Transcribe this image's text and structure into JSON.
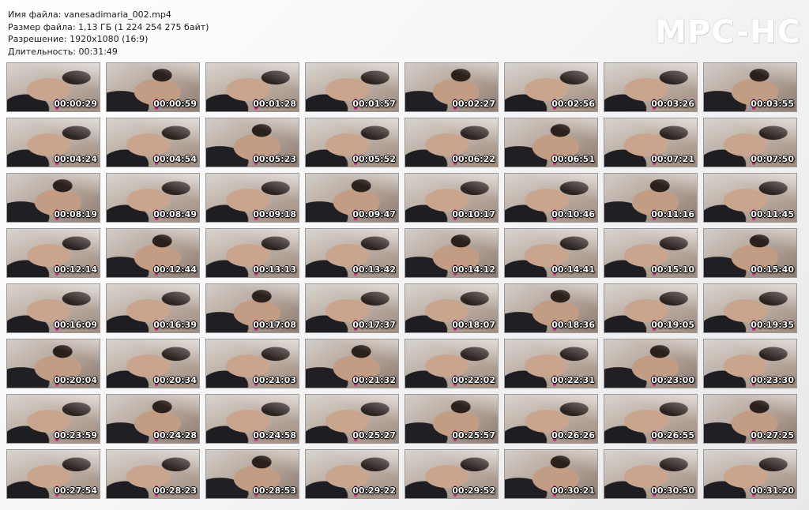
{
  "file_info": {
    "name_line": "Имя файла: vanesadimaria_002.mp4",
    "size_line": "Размер файла: 1,13 ГБ (1 224 254 275 байт)",
    "resolution_line": "Разрешение: 1920x1080 (16:9)",
    "duration_line": "Длительность: 00:31:49"
  },
  "logo": "MPC-HC",
  "thumbnails": [
    "00:00:29",
    "00:00:59",
    "00:01:28",
    "00:01:57",
    "00:02:27",
    "00:02:56",
    "00:03:26",
    "00:03:55",
    "00:04:24",
    "00:04:54",
    "00:05:23",
    "00:05:52",
    "00:06:22",
    "00:06:51",
    "00:07:21",
    "00:07:50",
    "00:08:19",
    "00:08:49",
    "00:09:18",
    "00:09:47",
    "00:10:17",
    "00:10:46",
    "00:11:16",
    "00:11:45",
    "00:12:14",
    "00:12:44",
    "00:13:13",
    "00:13:42",
    "00:14:12",
    "00:14:41",
    "00:15:10",
    "00:15:40",
    "00:16:09",
    "00:16:39",
    "00:17:08",
    "00:17:37",
    "00:18:07",
    "00:18:36",
    "00:19:05",
    "00:19:35",
    "00:20:04",
    "00:20:34",
    "00:21:03",
    "00:21:32",
    "00:22:02",
    "00:22:31",
    "00:23:00",
    "00:23:30",
    "00:23:59",
    "00:24:28",
    "00:24:58",
    "00:25:27",
    "00:25:57",
    "00:26:26",
    "00:26:55",
    "00:27:25",
    "00:27:54",
    "00:28:23",
    "00:28:53",
    "00:29:22",
    "00:29:52",
    "00:30:21",
    "00:30:50",
    "00:31:20"
  ]
}
